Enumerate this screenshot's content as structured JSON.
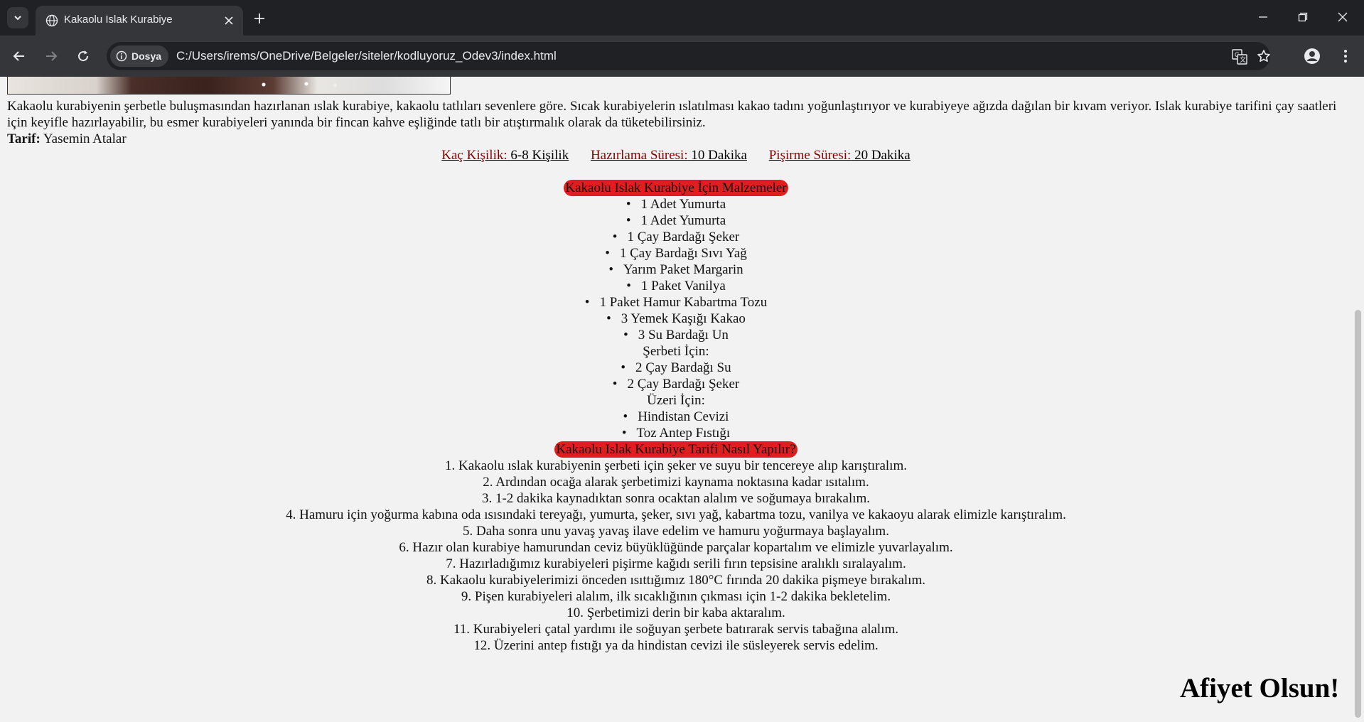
{
  "browser": {
    "tab_title": "Kakaolu Islak Kurabiye",
    "site_chip_label": "Dosya",
    "url": "C:/Users/irems/OneDrive/Belgeler/siteler/kodluyoruz_Odev3/index.html"
  },
  "page": {
    "intro": "Kakaolu kurabiyenin şerbetle buluşmasından hazırlanan ıslak kurabiye, kakaolu tatlıları sevenlere göre. Sıcak kurabiyelerin ıslatılması kakao tadını yoğunlaştırıyor ve kurabiyeye ağızda dağılan bir kıvam veriyor. Islak kurabiye tarifini çay saatleri için keyifle hazırlayabilir, bu esmer kurabiyeleri yanında bir fincan kahve eşliğinde tatlı bir atıştırmalık olarak da tüketebilirsiniz.",
    "credit_label": "Tarif:",
    "credit_name": "Yasemin Atalar",
    "meta": {
      "servings_key": "Kaç Kişilik:",
      "servings_val": "6-8 Kişilik",
      "prep_key": "Hazırlama Süresi:",
      "prep_val": "10 Dakika",
      "cook_key": "Pişirme Süresi:",
      "cook_val": "20 Dakika"
    },
    "ingredients_title": "Kakaolu Islak Kurabiye İçin Malzemeler",
    "ingredients": [
      "1 Adet Yumurta",
      "1 Adet Yumurta",
      "1 Çay Bardağı Şeker",
      "1 Çay Bardağı Sıvı Yağ",
      "Yarım Paket Margarin",
      "1 Paket Vanilya",
      "1 Paket Hamur Kabartma Tozu",
      "3 Yemek Kaşığı Kakao",
      "3 Su Bardağı Un"
    ],
    "syrup_heading": "Şerbeti İçin:",
    "syrup": [
      "2 Çay Bardağı Su",
      "2 Çay Bardağı Şeker"
    ],
    "topping_heading": "Üzeri İçin:",
    "topping": [
      "Hindistan Cevizi",
      "Toz Antep Fıstığı"
    ],
    "steps_title": "Kakaolu Islak Kurabiye Tarifi Nasıl Yapılır?",
    "steps": [
      "1. Kakaolu ıslak kurabiyenin şerbeti için şeker ve suyu bir tencereye alıp karıştıralım.",
      "2. Ardından ocağa alarak şerbetimizi kaynama noktasına kadar ısıtalım.",
      "3. 1-2 dakika kaynadıktan sonra ocaktan alalım ve soğumaya bırakalım.",
      "4. Hamuru için yoğurma kabına oda ısısındaki tereyağı, yumurta, şeker, sıvı yağ, kabartma tozu, vanilya ve kakaoyu alarak elimizle karıştıralım.",
      "5. Daha sonra unu yavaş yavaş ilave edelim ve hamuru yoğurmaya başlayalım.",
      "6. Hazır olan kurabiye hamurundan ceviz büyüklüğünde parçalar kopartalım ve elimizle yuvarlayalım.",
      "7. Hazırladığımız kurabiyeleri pişirme kağıdı serili fırın tepsisine aralıklı sıralayalım.",
      "8. Kakaolu kurabiyelerimizi önceden ısıttığımız 180°C fırında 20 dakika pişmeye bırakalım.",
      "9. Pişen kurabiyeleri alalım, ilk sıcaklığının çıkması için 1-2 dakika bekletelim.",
      "10. Şerbetimizi derin bir kaba aktaralım.",
      "11. Kurabiyeleri çatal yardımı ile soğuyan şerbete batırarak servis tabağına alalım.",
      "12. Üzerini antep fıstığı ya da hindistan cevizi ile süsleyerek servis edelim."
    ],
    "closing": "Afiyet Olsun!"
  },
  "colors": {
    "pill": "#dd1f1f",
    "meta_key": "#8b0000",
    "chrome_dark": "#202124",
    "chrome_mid": "#35363a"
  }
}
